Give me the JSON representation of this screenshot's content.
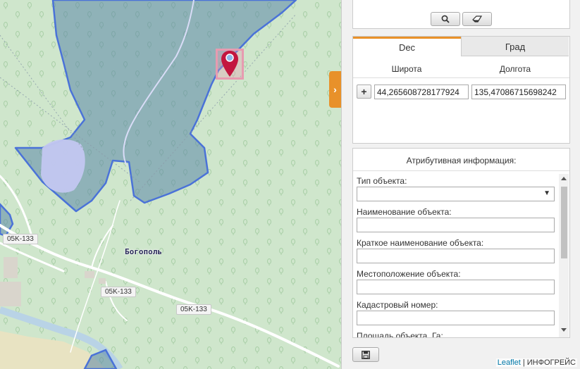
{
  "map": {
    "place_label": "Богополь",
    "road_labels": [
      "05K-133",
      "05K-133",
      "05K-133"
    ]
  },
  "search": {
    "search_icon": "search-icon",
    "clear_icon": "eraser-icon"
  },
  "coords": {
    "tabs": [
      "Dec",
      "Град"
    ],
    "active_tab": "Dec",
    "lat_header": "Широта",
    "lon_header": "Долгота",
    "add_label": "+",
    "latitude": "44,265608728177924",
    "longitude": "135,47086715698242"
  },
  "attributes": {
    "title": "Атрибутивная информация:",
    "fields": [
      {
        "label": "Тип объекта:",
        "type": "select",
        "value": ""
      },
      {
        "label": "Наименование объекта:",
        "type": "text",
        "value": ""
      },
      {
        "label": "Краткое наименование объекта:",
        "type": "text",
        "value": ""
      },
      {
        "label": "Местоположение объекта:",
        "type": "text",
        "value": ""
      },
      {
        "label": "Кадастровый номер:",
        "type": "text",
        "value": ""
      },
      {
        "label": "Площадь объекта, Га:",
        "type": "text",
        "value": ""
      }
    ]
  },
  "toolbar": {
    "save_icon": "floppy-disk-icon",
    "toggle_icon": "chevron-right-icon"
  },
  "attribution": {
    "leaflet": "Leaflet",
    "separator": "|",
    "provider": "ИНФОГРЕЙС"
  },
  "colors": {
    "accent": "#e8912a",
    "polygon_stroke": "#4a72d8",
    "polygon_fill": "#5b87a8",
    "marker": "#c3163f",
    "forest": "#cfe6cc"
  }
}
